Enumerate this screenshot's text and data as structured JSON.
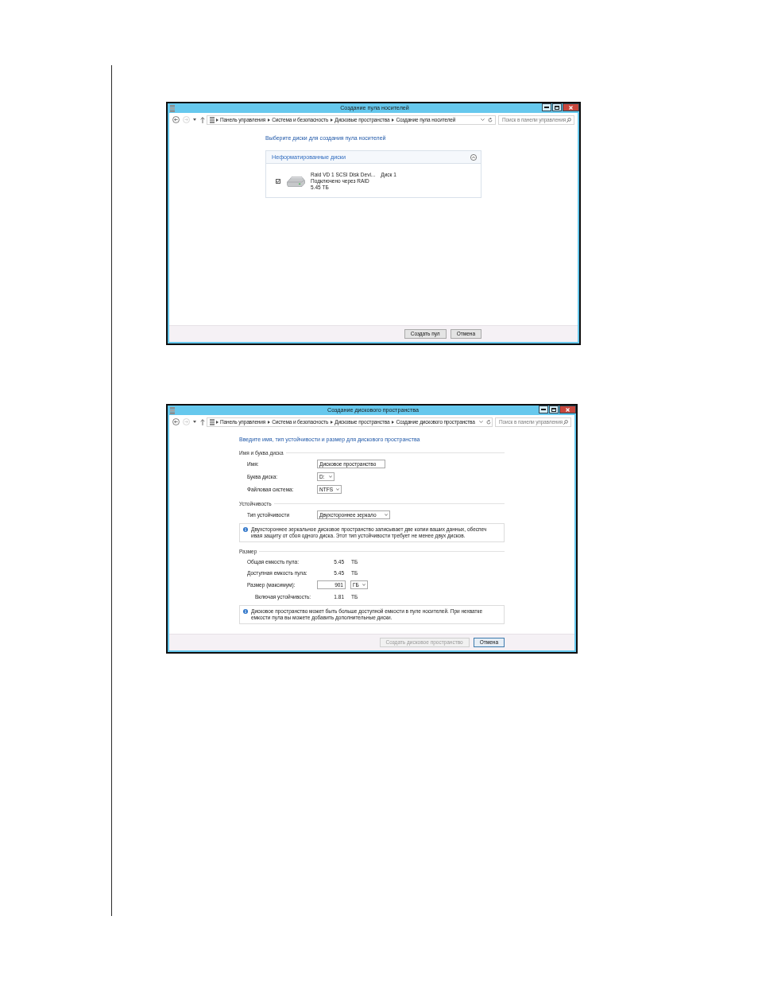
{
  "windows": [
    {
      "kind": "pool",
      "title": "Создание пула носителей",
      "nav_buttons": [
        {
          "kind": "back",
          "disabled": false
        },
        {
          "kind": "forward",
          "disabled": true
        },
        {
          "kind": "history",
          "disabled": false
        },
        {
          "kind": "up",
          "disabled": false
        }
      ],
      "breadcrumb": [
        "Панель управления",
        "Система и безопасность",
        "Дисковые пространства",
        "Создание пула носителей"
      ],
      "search": {
        "placeholder": "Поиск в панели управления"
      },
      "heading": "Выберите диски для создания пула носителей",
      "group": {
        "title": "Неформатированные диски",
        "expanded": true,
        "disks": [
          {
            "checked": true,
            "name": "Raid VD 1 SCSI Disk Devi...",
            "number": "Диск 1",
            "connection": "Подключено через RAID",
            "capacity": "5.45 ТБ"
          }
        ]
      },
      "buttons": [
        {
          "label": "Создать пул",
          "disabled": false,
          "default": false
        },
        {
          "label": "Отмена",
          "disabled": false,
          "default": false
        }
      ]
    },
    {
      "kind": "space",
      "title": "Создание дискового пространства",
      "nav_buttons": [
        {
          "kind": "back",
          "disabled": false
        },
        {
          "kind": "forward",
          "disabled": true
        },
        {
          "kind": "history",
          "disabled": false
        },
        {
          "kind": "up",
          "disabled": false
        }
      ],
      "breadcrumb": [
        "Панель управления",
        "Система и безопасность",
        "Дисковые пространства",
        "Создание дискового пространства"
      ],
      "search": {
        "placeholder": "Поиск в панели управления"
      },
      "heading": "Введите имя, тип устойчивости и размер для дискового пространства",
      "sections": [
        {
          "title": "Имя и буква диска",
          "rows": [
            {
              "kind": "text",
              "label": "Имя:",
              "value": "Дисковое пространство"
            },
            {
              "kind": "select",
              "label": "Буква диска:",
              "value": "D:"
            },
            {
              "kind": "select",
              "label": "Файловая система:",
              "value": "NTFS"
            }
          ]
        },
        {
          "title": "Устойчивость",
          "rows": [
            {
              "kind": "select",
              "label": "Тип устойчивости",
              "value": "Двухстороннее зеркало"
            }
          ],
          "note": [
            "Двухстороннее зеркальное дисковое пространство записывает две копии ваших данных, обеспеч",
            "ивая защиту от сбоя одного диска. Этот тип устойчивости требует не менее двух дисков."
          ]
        },
        {
          "title": "Размер",
          "rows": [
            {
              "kind": "reading",
              "label": "Общая емкость пула:",
              "value": "5.45",
              "unit": "ТБ"
            },
            {
              "kind": "reading",
              "label": "Доступная емкость пула:",
              "value": "5.45",
              "unit": "ТБ"
            },
            {
              "kind": "size",
              "label": "Размер (максимум):",
              "value": "901",
              "unit": "ГБ"
            },
            {
              "kind": "sub_reading",
              "label": "Включая устойчивость:",
              "value": "1.81",
              "unit": "ТБ"
            }
          ],
          "note": [
            "Дисковое пространство может быть больше доступной емкости в пуле носителей. При нехватке",
            "емкости пула вы можете добавить дополнительные диски."
          ]
        }
      ],
      "buttons": [
        {
          "label": "Создать дисковое пространство",
          "disabled": true,
          "default": false
        },
        {
          "label": "Отмена",
          "disabled": false,
          "default": true
        }
      ]
    }
  ]
}
